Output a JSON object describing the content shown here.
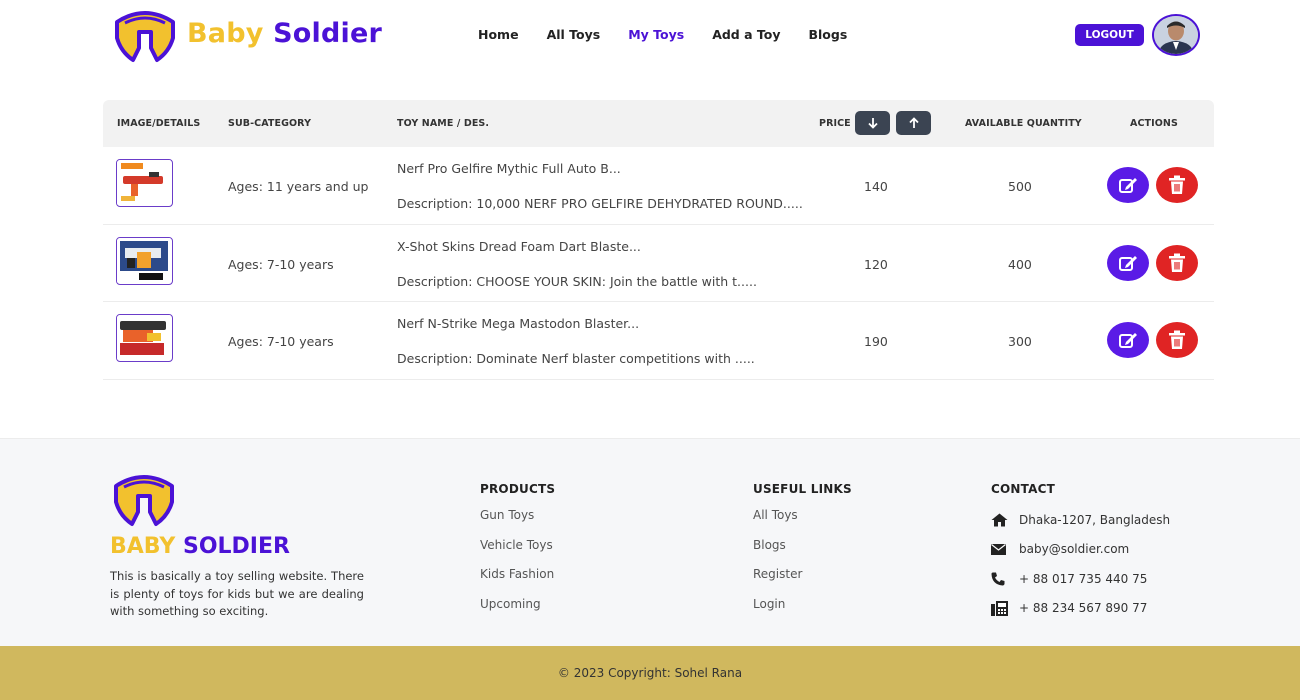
{
  "header": {
    "brand_first": "Baby",
    "brand_second": "Soldier",
    "nav": [
      "Home",
      "All Toys",
      "My Toys",
      "Add a Toy",
      "Blogs"
    ],
    "active_nav": "My Toys",
    "logout_label": "LOGOUT"
  },
  "table": {
    "headers": {
      "image": "IMAGE/DETAILS",
      "subcategory": "SUB-CATEGORY",
      "name": "TOY NAME / DES.",
      "price": "PRICE",
      "quantity": "AVAILABLE QUANTITY",
      "actions": "ACTIONS"
    },
    "sort_desc_icon": "arrow-down-icon",
    "sort_asc_icon": "arrow-up-icon",
    "rows": [
      {
        "subcategory": "Ages: 11 years and up",
        "name": "Nerf Pro Gelfire Mythic Full Auto B...",
        "description": "Description: 10,000 NERF PRO GELFIRE DEHYDRATED ROUND.....",
        "price": "140",
        "quantity": "500"
      },
      {
        "subcategory": "Ages: 7-10 years",
        "name": "X-Shot Skins Dread Foam Dart Blaste...",
        "description": "Description: CHOOSE YOUR SKIN: Join the battle with t.....",
        "price": "120",
        "quantity": "400"
      },
      {
        "subcategory": "Ages: 7-10 years",
        "name": "Nerf N-Strike Mega Mastodon Blaster...",
        "description": "Description: Dominate Nerf blaster competitions with .....",
        "price": "190",
        "quantity": "300"
      }
    ]
  },
  "footer": {
    "brand_first": "BABY",
    "brand_second": "SOLDIER",
    "about": "This is basically a toy selling website. There is plenty of toys for kids but we are dealing with something so exciting.",
    "products": {
      "title": "PRODUCTS",
      "links": [
        "Gun Toys",
        "Vehicle Toys",
        "Kids Fashion",
        "Upcoming"
      ]
    },
    "useful": {
      "title": "USEFUL LINKS",
      "links": [
        "All Toys",
        "Blogs",
        "Register",
        "Login"
      ]
    },
    "contact": {
      "title": "CONTACT",
      "address": "Dhaka-1207, Bangladesh",
      "email": "baby@soldier.com",
      "phone": "+ 88 017 735 440 75",
      "fax": "+ 88 234 567 890 77"
    },
    "copyright": "© 2023 Copyright: Sohel Rana"
  },
  "colors": {
    "brand_purple": "#4b12d6",
    "brand_yellow": "#f2c12e",
    "delete_red": "#e02424",
    "footer_bar": "#d0b85e"
  }
}
